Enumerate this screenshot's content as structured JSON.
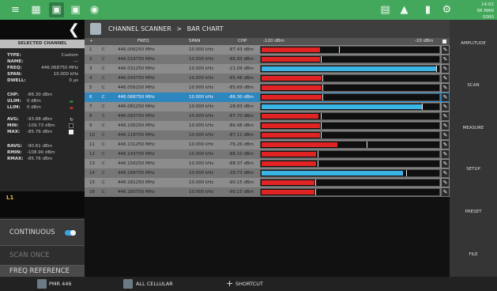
{
  "topbar": {
    "status_line1": "14:02",
    "status_line2": "SR MAN 0000"
  },
  "left_panel": {
    "selected_channel_header": "SELECTED CHANNEL",
    "info": [
      {
        "label": "TYPE:",
        "value": "Custom"
      },
      {
        "label": "NAME:",
        "value": "---"
      },
      {
        "label": "FREQ:",
        "value": "446.068750 MHz"
      },
      {
        "label": "SPAN:",
        "value": "10.000 kHz"
      },
      {
        "label": "DWELL:",
        "value": "0 µs"
      }
    ],
    "limits": [
      {
        "label": "CHP:",
        "value": "-86.30 dBm"
      },
      {
        "label": "ULIM:",
        "value": "0 dBm"
      },
      {
        "label": "LLIM:",
        "value": "0 dBm"
      }
    ],
    "stats": [
      {
        "label": "AVG:",
        "value": "-93.88 dBm"
      },
      {
        "label": "MIN:",
        "value": "-109.73 dBm"
      },
      {
        "label": "MAX:",
        "value": "-85.76 dBm"
      }
    ],
    "rstats": [
      {
        "label": "RAVG:",
        "value": "-90.61 dBm"
      },
      {
        "label": "RMIN:",
        "value": "-108.90 dBm"
      },
      {
        "label": "RMAX:",
        "value": "-85.76 dBm"
      }
    ],
    "marker": "L1",
    "continuous_label": "CONTINUOUS",
    "continuous_on": true,
    "scan_once_label": "SCAN ONCE",
    "freq_reference_label": "FREQ REFERENCE"
  },
  "breadcrumb": {
    "root": "CHANNEL SCANNER",
    "separator": ">",
    "current": "BAR CHART"
  },
  "table": {
    "headers": {
      "add": "+",
      "freq": "FREQ",
      "span": "SPAN",
      "chp": "CHP",
      "scale_min": "-120 dBm",
      "scale_max": "-20 dBm"
    },
    "rows": [
      {
        "num": "1",
        "type": "C",
        "freq": "446.006250 MHz",
        "span": "10.000 kHz",
        "chp": "-87.43 dBm",
        "level": 0.33,
        "hold": 0.44,
        "color": "red"
      },
      {
        "num": "2",
        "type": "C",
        "freq": "446.018750 MHz",
        "span": "10.000 kHz",
        "chp": "-86.93 dBm",
        "level": 0.33,
        "hold": 0.34,
        "color": "red"
      },
      {
        "num": "3",
        "type": "C",
        "freq": "446.031250 MHz",
        "span": "10.000 kHz",
        "chp": "-21.09 dBm",
        "level": 0.99,
        "hold": 0.99,
        "color": "blue"
      },
      {
        "num": "4",
        "type": "C",
        "freq": "446.043750 MHz",
        "span": "10.000 kHz",
        "chp": "-85.48 dBm",
        "level": 0.34,
        "hold": 0.35,
        "color": "red"
      },
      {
        "num": "5",
        "type": "C",
        "freq": "446.056250 MHz",
        "span": "10.000 kHz",
        "chp": "-85.69 dBm",
        "level": 0.34,
        "hold": 0.35,
        "color": "red"
      },
      {
        "num": "6",
        "type": "C",
        "freq": "446.068750 MHz",
        "span": "10.000 kHz",
        "chp": "-86.30 dBm",
        "level": 0.34,
        "hold": 0.35,
        "color": "red",
        "selected": true
      },
      {
        "num": "7",
        "type": "C",
        "freq": "446.081250 MHz",
        "span": "10.000 kHz",
        "chp": "-28.83 dBm",
        "level": 0.91,
        "hold": 0.91,
        "color": "blue"
      },
      {
        "num": "8",
        "type": "C",
        "freq": "446.093750 MHz",
        "span": "10.000 kHz",
        "chp": "-87.70 dBm",
        "level": 0.32,
        "hold": 0.34,
        "color": "red"
      },
      {
        "num": "9",
        "type": "C",
        "freq": "446.106250 MHz",
        "span": "10.000 kHz",
        "chp": "-86.48 dBm",
        "level": 0.33,
        "hold": 0.34,
        "color": "red"
      },
      {
        "num": "10",
        "type": "C",
        "freq": "446.118750 MHz",
        "span": "10.000 kHz",
        "chp": "-87.11 dBm",
        "level": 0.33,
        "hold": 0.34,
        "color": "red"
      },
      {
        "num": "11",
        "type": "C",
        "freq": "446.131250 MHz",
        "span": "10.000 kHz",
        "chp": "-76.26 dBm",
        "level": 0.43,
        "hold": 0.6,
        "color": "red"
      },
      {
        "num": "12",
        "type": "C",
        "freq": "446.143750 MHz",
        "span": "10.000 kHz",
        "chp": "-88.10 dBm",
        "level": 0.31,
        "hold": 0.32,
        "color": "red"
      },
      {
        "num": "13",
        "type": "C",
        "freq": "446.156250 MHz",
        "span": "10.000 kHz",
        "chp": "-88.37 dBm",
        "level": 0.31,
        "hold": 0.32,
        "color": "red"
      },
      {
        "num": "14",
        "type": "C",
        "freq": "446.168750 MHz",
        "span": "10.000 kHz",
        "chp": "-39.73 dBm",
        "level": 0.8,
        "hold": 0.82,
        "color": "blue"
      },
      {
        "num": "15",
        "type": "C",
        "freq": "446.181250 MHz",
        "span": "10.000 kHz",
        "chp": "-90.15 dBm",
        "level": 0.3,
        "hold": 0.31,
        "color": "red"
      },
      {
        "num": "16",
        "type": "C",
        "freq": "446.193750 MHz",
        "span": "10.000 kHz",
        "chp": "-90.15 dBm",
        "level": 0.3,
        "hold": 0.31,
        "color": "red"
      }
    ]
  },
  "right_menu": [
    "AMPLITUDE",
    "SCAN",
    "MEASURE",
    "SETUP",
    "PRESET",
    "FILE"
  ],
  "bottom_bar": {
    "item1": "PMR 446",
    "item2": "ALL CELLULAR",
    "item3_prefix": "+",
    "item3": "SHORTCUT"
  },
  "colors": {
    "accent_green": "#43a85c",
    "bar_red": "#e02424",
    "bar_blue": "#3cb4e6",
    "selected_row": "#2e86bf",
    "toggle_blue": "#3ba3e0",
    "ulim_green": "#2f9e44",
    "llim_red": "#d43a2f"
  }
}
